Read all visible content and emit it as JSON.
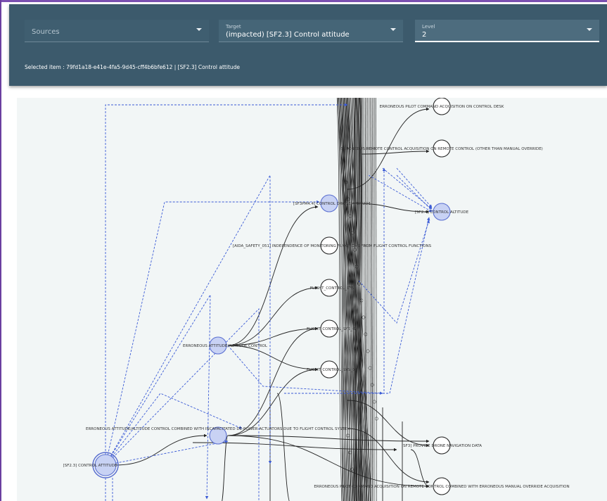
{
  "toolbar": {
    "sources": {
      "placeholder": "Sources"
    },
    "target": {
      "label": "Target",
      "value": "(impacted) [SF2.3] Control attitude"
    },
    "level": {
      "label": "Level",
      "value": "2"
    },
    "selected_item": "Selected item : 79fd1a18-e41e-4fa5-9d45-cff4b6bfe612 | [SF2.3] Control attitude"
  },
  "graph": {
    "colors": {
      "highlight_node": "#c8d2f4",
      "highlight_stroke": "#5a6fd0",
      "dashed_edge": "#3b5bd6",
      "solid_edge": "#222222"
    },
    "nodes": {
      "n_control_desk": "ERRONEOUS PILOT COMMAND ACQUISITION ON CONTROL DESK",
      "n_remote_control": "ERRONEOUS REMOTE CONTROL ACQUISITION ON REMOTE CONTROL (OTHER THAN MANUAL OVERRIDE)",
      "n_control_drone": "[SF3PM4.4] CONTROL DRONE ATTITUDE",
      "n_sf24": "[SF2.4] CONTROL ALTITUDE",
      "n_aida": "[AIDA_SAFETY_051] INDEPENDENCE OF MONITORING FUNCTIONS FROM FLIGHT CONTROL FUNCTIONS",
      "n_fc1": "FLIGHT_CONTROL_SYS",
      "n_fc2": "FLIGHT_CONTROL_SYS_02",
      "n_fc3": "FLIGHT_CONTROL_SYS_03",
      "n_err_att": "ERRONEOUS ATTITUDE/ALTITUDE CONTROL",
      "n_erroneous_combined": "ERRONEOUS ATTITUDE/ALTITUDE CONTROL COMBINED WITH INCAPACITATED DE-POWER ACTUATORS DUE TO FLIGHT CONTROL SYSTEM",
      "n_sf23": "[SF2.3] CONTROL ATTITUDE",
      "n_sf3": "[SF3] PROVIDE DRONE NAVIGATION DATA",
      "n_bottom": "ERRONEOUS PILOT COMMAND ACQUISITION ON REMOTE CONTROL COMBINED WITH ERRONEOUS MANUAL OVERRIDE ACQUISITION"
    }
  }
}
